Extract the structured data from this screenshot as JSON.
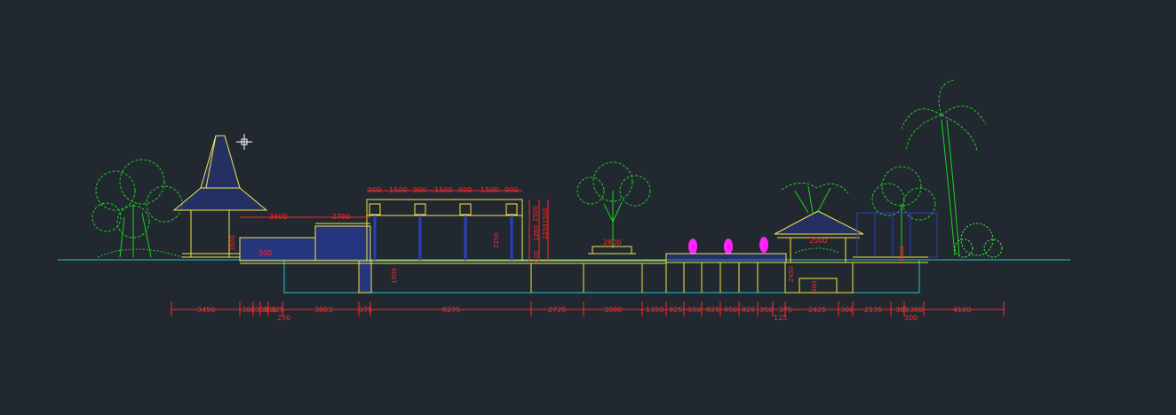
{
  "drawing": {
    "bottom_dimensions": [
      "3450",
      "300",
      "300",
      "300",
      "325",
      "3803",
      "375",
      "8275",
      "2725",
      "3000",
      "1350",
      "925",
      "950",
      "925",
      "950",
      "925",
      "350",
      "375",
      "2425",
      "300",
      "2135",
      "385",
      "300",
      "4100"
    ],
    "bottom_sub_dimensions": [
      "250",
      "125",
      "300"
    ],
    "pavilion_dimensions": [
      "3900",
      "2700"
    ],
    "gate_top_dimensions": [
      "900",
      "1500",
      "900",
      "1500",
      "900",
      "1500",
      "900"
    ],
    "gate_side_dimensions": [
      "2250",
      "1260",
      "2250",
      "1500",
      "600",
      "1500",
      "2500"
    ],
    "left_dimensions": [
      "3500",
      "300"
    ],
    "planter_dimension": "2800",
    "gazebo_dimensions": [
      "2500",
      "300",
      "2450",
      "2500"
    ],
    "colors": {
      "background": "#212830",
      "structure": "#f2e64a",
      "dimension": "#ff2a2a",
      "water": "#2a3fbf",
      "tree": "#1fd21f",
      "ground": "#20c8c8",
      "figure": "#ff22ff",
      "cursor": "#ffffff"
    }
  }
}
